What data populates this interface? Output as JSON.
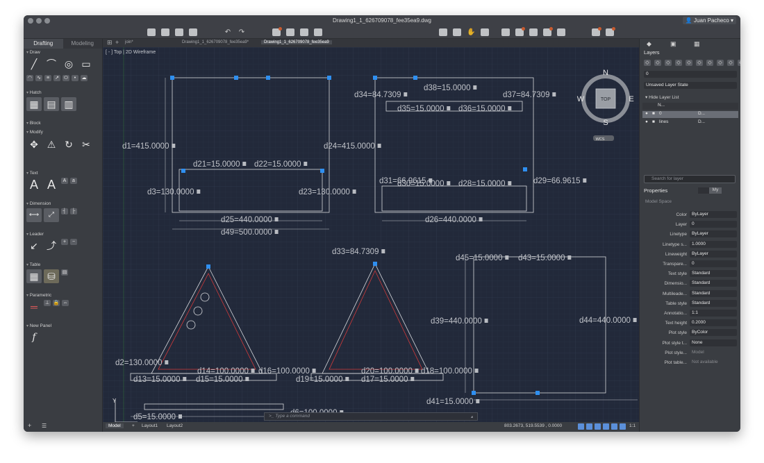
{
  "window": {
    "title": "Drawing1_1_626709078_fee35ea9.dwg",
    "user": "Juan Pacheco"
  },
  "left_panel": {
    "tabs": [
      "Drafting",
      "Modeling"
    ],
    "sections": [
      "Draw",
      "Hatch",
      "Block",
      "Modify",
      "Text",
      "Dimension",
      "Leader",
      "Table",
      "Parametric",
      "New Panel"
    ]
  },
  "doc_tabs": {
    "tabs": [
      "join*",
      "Drawing1_1_626709078_fee35ea9*",
      "Drawing1_1_626709078_fee35ea9"
    ],
    "active": "Drawing1_1_626709078_fee35ea9"
  },
  "view": {
    "label": "[ - ] Top | 2D Wireframe"
  },
  "viewcube": {
    "n": "N",
    "s": "S",
    "e": "E",
    "w": "W",
    "top": "TOP",
    "wcs": "WCS"
  },
  "dimensions": [
    "d1=415.0000",
    "d2=130.0000",
    "d3=130.0000",
    "d13=15.0000",
    "d14=100.0000",
    "d15=15.0000",
    "d16=100.0000",
    "d17=15.0000",
    "d18=100.0000",
    "d19=15.0000",
    "d20=100.0000",
    "d21=15.0000",
    "d22=15.0000",
    "d23=130.0000",
    "d24=415.0000",
    "d25=440.0000",
    "d26=440.0000",
    "d28=15.0000",
    "d29=66.9615",
    "d30=15.0000",
    "d31=66.9615",
    "d33=84.7309",
    "d34=84.7309",
    "d35=15.0000",
    "d36=15.0000",
    "d37=84.7309",
    "d38=15.0000",
    "d39=440.0000",
    "d41=15.0000",
    "d43=15.0000",
    "d44=440.0000",
    "d45=15.0000",
    "d49=500.0000",
    "d5=15.0000",
    "d6=100.0000"
  ],
  "layers_panel": {
    "title": "Layers",
    "current_layer": "0",
    "layer_state": "Unsaved Layer State",
    "hide_list": "Hide Layer List",
    "columns": [
      "N..."
    ],
    "layers": [
      {
        "name": "0",
        "desc": "D..."
      },
      {
        "name": "lines",
        "desc": "D..."
      }
    ],
    "search_placeholder": "Search for layer"
  },
  "properties_panel": {
    "title": "Properties",
    "tab_a": "",
    "tab_b": "My",
    "model_space": "Model Space",
    "rows": [
      {
        "label": "Color",
        "value": "ByLayer"
      },
      {
        "label": "Layer",
        "value": "0"
      },
      {
        "label": "Linetype",
        "value": "ByLayer"
      },
      {
        "label": "Linetype s...",
        "value": "1.0000"
      },
      {
        "label": "Lineweight",
        "value": "ByLayer"
      },
      {
        "label": "Transpare...",
        "value": "0"
      },
      {
        "label": "Text style",
        "value": "Standard"
      },
      {
        "label": "Dimensio...",
        "value": "Standard"
      },
      {
        "label": "Multileade...",
        "value": "Standard"
      },
      {
        "label": "Table style",
        "value": "Standard"
      },
      {
        "label": "Annotatio...",
        "value": "1:1"
      },
      {
        "label": "Text height",
        "value": "0.2000"
      },
      {
        "label": "Plot style",
        "value": "ByColor"
      },
      {
        "label": "Plot style t...",
        "value": "None"
      },
      {
        "label": "Plot style...",
        "value": "Model"
      },
      {
        "label": "Plot table...",
        "value": "Not available"
      }
    ]
  },
  "command_line": {
    "prompt": ">_",
    "placeholder": "Type a command"
  },
  "status_bar": {
    "tabs": [
      "Model",
      "Layout1",
      "Layout2"
    ],
    "coords": "803.2673, 519.5539 , 0.0000",
    "scale": "1:1"
  },
  "colors": {
    "canvas": "#22293a",
    "red_outline": "#d23a3a",
    "dim_text": "#c0c3c9",
    "accent_blue": "#2f8ff0"
  }
}
